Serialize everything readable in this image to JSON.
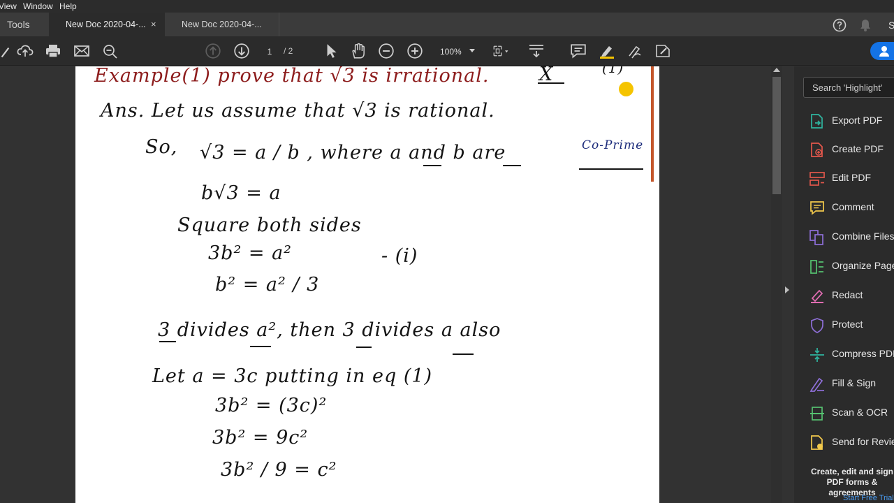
{
  "menu": {
    "items": [
      "View",
      "Window",
      "Help"
    ]
  },
  "tabs": {
    "tools_label": "Tools",
    "documents": [
      {
        "label": "New Doc 2020-04-...",
        "close": "×"
      },
      {
        "label": "New Doc 2020-04-..."
      }
    ]
  },
  "toolbar": {
    "current_page": "1",
    "total_pages": "/ 2",
    "zoom": "100%"
  },
  "document": {
    "lines": [
      {
        "text": "Example(1) prove that √3 is irrational.",
        "color": "#8d1c1c"
      },
      {
        "text": "X"
      },
      {
        "text": "(1)"
      },
      {
        "text": "Ans. Let us assume that √3 is rational."
      },
      {
        "text": "So,"
      },
      {
        "text": "√3 = a / b ,  where a and b are"
      },
      {
        "text": "Co-Prime"
      },
      {
        "text": "b√3 = a"
      },
      {
        "text": "Square both sides"
      },
      {
        "text": "3b² = a²"
      },
      {
        "text": "- (i)"
      },
      {
        "text": "b² = a² / 3"
      },
      {
        "text": "3 divides a², then 3 divides a also"
      },
      {
        "text": "Let a = 3c  putting in eq (1)"
      },
      {
        "text": "3b² = (3c)²"
      },
      {
        "text": "3b² = 9c²"
      },
      {
        "text": "3b² / 9 = c²"
      }
    ],
    "highlight_color": "#f5c400"
  },
  "right_pane": {
    "search_placeholder": "Search 'Highlight'",
    "tools": [
      {
        "label": "Export PDF",
        "icon": "export-pdf-icon",
        "color": "#2fb5a0"
      },
      {
        "label": "Create PDF",
        "icon": "create-pdf-icon",
        "color": "#e2574c"
      },
      {
        "label": "Edit PDF",
        "icon": "edit-pdf-icon",
        "color": "#e2574c"
      },
      {
        "label": "Comment",
        "icon": "comment-icon",
        "color": "#f2c94c"
      },
      {
        "label": "Combine Files",
        "icon": "combine-files-icon",
        "color": "#8e6fd8"
      },
      {
        "label": "Organize Pages",
        "icon": "organize-pages-icon",
        "color": "#56c271"
      },
      {
        "label": "Redact",
        "icon": "redact-icon",
        "color": "#e06db2"
      },
      {
        "label": "Protect",
        "icon": "protect-icon",
        "color": "#8e6fd8"
      },
      {
        "label": "Compress PDF",
        "icon": "compress-pdf-icon",
        "color": "#2fb5a0"
      },
      {
        "label": "Fill & Sign",
        "icon": "fill-sign-icon",
        "color": "#8e6fd8"
      },
      {
        "label": "Scan & OCR",
        "icon": "scan-ocr-icon",
        "color": "#56c271"
      },
      {
        "label": "Send for Review",
        "icon": "send-review-icon",
        "color": "#f2c94c"
      }
    ],
    "promo": "Create, edit and sign PDF forms & agreements",
    "trial_link": "Start Free Trial"
  },
  "colors": {
    "accent": "#1473e6",
    "background": "#323232",
    "toolbar": "#2b2b2b"
  }
}
